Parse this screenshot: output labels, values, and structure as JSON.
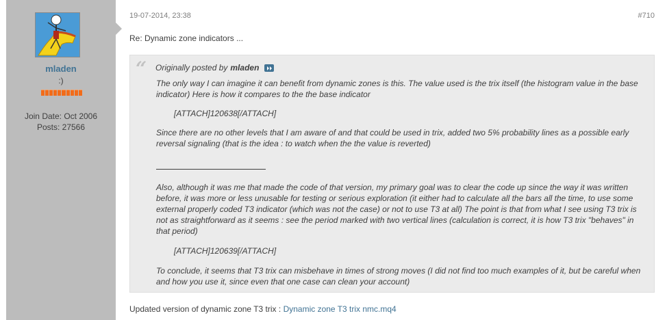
{
  "user": {
    "name": "mladen",
    "title": ":)",
    "reputation_pips": 10,
    "join_date": "Join Date: Oct 2006",
    "posts": "Posts: 27566"
  },
  "post": {
    "date": "19-07-2014, 23:38",
    "number": "#710",
    "title": "Re: Dynamic zone indicators ...",
    "quote": {
      "intro": "Originally posted by",
      "author": "mladen",
      "p1": "The only way I can imagine it can benefit from dynamic zones is this. The value used is the trix itself (the histogram value in the base indicator) Here is how it compares to the the base indicator",
      "attach1": "[ATTACH]120638[/ATTACH]",
      "p2": "Since there are no other levels that I am aware of and that could be used in trix, added two 5% probability lines as a possible early reversal signaling (that is the idea : to watch when the the value is reverted)",
      "p3": "Also, although it was me that made the code of that version, my primary goal was to clear the code up since the way it was written before, it was more or less unusable for testing or serious exploration (it either had to calculate all the bars all the time, to use some external properly coded T3 indicator (which was not the case) or not to use T3 at all) The point is that from what I see using T3 trix is not as straightforward as it seems : see the period marked with two vertical lines (calculation is correct, it is how T3 trix \"behaves\" in that period)",
      "attach2": "[ATTACH]120639[/ATTACH]",
      "p4": "To conclude, it seems that T3 trix can misbehave in times of strong moves (I did not find too much examples of it, but be careful when and how you use it, since even that one case can clean your account)"
    },
    "footer_text": "Updated version of dynamic zone T3 trix : ",
    "footer_link": "Dynamic zone T3 trix nmc.mq4"
  },
  "icons": {
    "quote": "quote-mark-icon",
    "view_post": "view-post-icon"
  },
  "colors": {
    "sidebar": "#bcbcbc",
    "username": "#417394",
    "link": "#417394",
    "reputation": "#f26c1a",
    "quote_bg": "#ebebeb"
  }
}
